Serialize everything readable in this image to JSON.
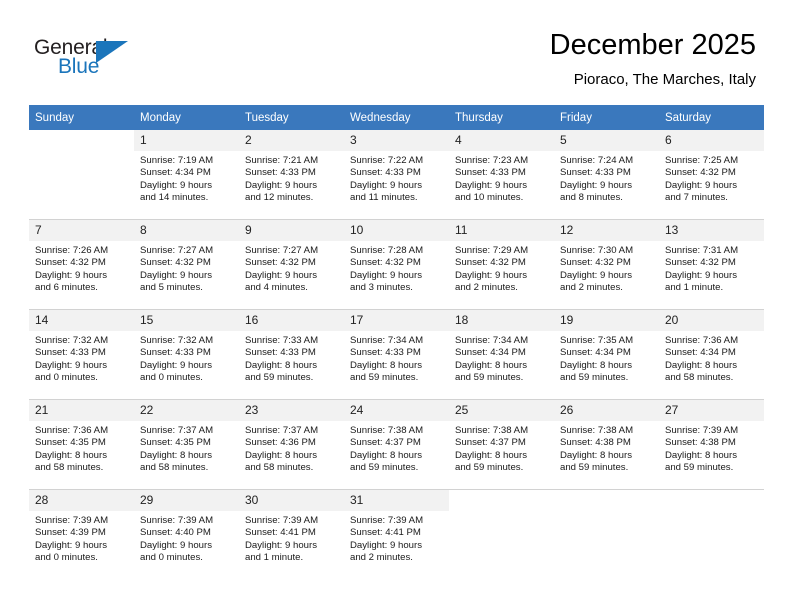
{
  "brand": {
    "name_part1": "General",
    "name_part2": "Blue",
    "triangle_color": "#1b75bb"
  },
  "header": {
    "title": "December 2025",
    "subtitle": "Pioraco, The Marches, Italy",
    "header_bg": "#3a78bd"
  },
  "weekdays": [
    "Sunday",
    "Monday",
    "Tuesday",
    "Wednesday",
    "Thursday",
    "Friday",
    "Saturday"
  ],
  "labels": {
    "sunrise": "Sunrise:",
    "sunset": "Sunset:",
    "daylight": "Daylight:"
  },
  "weeks": [
    [
      {
        "day": "",
        "sunrise": "",
        "sunset": "",
        "daylight1": "",
        "daylight2": ""
      },
      {
        "day": "1",
        "sunrise": "Sunrise: 7:19 AM",
        "sunset": "Sunset: 4:34 PM",
        "daylight1": "Daylight: 9 hours",
        "daylight2": "and 14 minutes."
      },
      {
        "day": "2",
        "sunrise": "Sunrise: 7:21 AM",
        "sunset": "Sunset: 4:33 PM",
        "daylight1": "Daylight: 9 hours",
        "daylight2": "and 12 minutes."
      },
      {
        "day": "3",
        "sunrise": "Sunrise: 7:22 AM",
        "sunset": "Sunset: 4:33 PM",
        "daylight1": "Daylight: 9 hours",
        "daylight2": "and 11 minutes."
      },
      {
        "day": "4",
        "sunrise": "Sunrise: 7:23 AM",
        "sunset": "Sunset: 4:33 PM",
        "daylight1": "Daylight: 9 hours",
        "daylight2": "and 10 minutes."
      },
      {
        "day": "5",
        "sunrise": "Sunrise: 7:24 AM",
        "sunset": "Sunset: 4:33 PM",
        "daylight1": "Daylight: 9 hours",
        "daylight2": "and 8 minutes."
      },
      {
        "day": "6",
        "sunrise": "Sunrise: 7:25 AM",
        "sunset": "Sunset: 4:32 PM",
        "daylight1": "Daylight: 9 hours",
        "daylight2": "and 7 minutes."
      }
    ],
    [
      {
        "day": "7",
        "sunrise": "Sunrise: 7:26 AM",
        "sunset": "Sunset: 4:32 PM",
        "daylight1": "Daylight: 9 hours",
        "daylight2": "and 6 minutes."
      },
      {
        "day": "8",
        "sunrise": "Sunrise: 7:27 AM",
        "sunset": "Sunset: 4:32 PM",
        "daylight1": "Daylight: 9 hours",
        "daylight2": "and 5 minutes."
      },
      {
        "day": "9",
        "sunrise": "Sunrise: 7:27 AM",
        "sunset": "Sunset: 4:32 PM",
        "daylight1": "Daylight: 9 hours",
        "daylight2": "and 4 minutes."
      },
      {
        "day": "10",
        "sunrise": "Sunrise: 7:28 AM",
        "sunset": "Sunset: 4:32 PM",
        "daylight1": "Daylight: 9 hours",
        "daylight2": "and 3 minutes."
      },
      {
        "day": "11",
        "sunrise": "Sunrise: 7:29 AM",
        "sunset": "Sunset: 4:32 PM",
        "daylight1": "Daylight: 9 hours",
        "daylight2": "and 2 minutes."
      },
      {
        "day": "12",
        "sunrise": "Sunrise: 7:30 AM",
        "sunset": "Sunset: 4:32 PM",
        "daylight1": "Daylight: 9 hours",
        "daylight2": "and 2 minutes."
      },
      {
        "day": "13",
        "sunrise": "Sunrise: 7:31 AM",
        "sunset": "Sunset: 4:32 PM",
        "daylight1": "Daylight: 9 hours",
        "daylight2": "and 1 minute."
      }
    ],
    [
      {
        "day": "14",
        "sunrise": "Sunrise: 7:32 AM",
        "sunset": "Sunset: 4:33 PM",
        "daylight1": "Daylight: 9 hours",
        "daylight2": "and 0 minutes."
      },
      {
        "day": "15",
        "sunrise": "Sunrise: 7:32 AM",
        "sunset": "Sunset: 4:33 PM",
        "daylight1": "Daylight: 9 hours",
        "daylight2": "and 0 minutes."
      },
      {
        "day": "16",
        "sunrise": "Sunrise: 7:33 AM",
        "sunset": "Sunset: 4:33 PM",
        "daylight1": "Daylight: 8 hours",
        "daylight2": "and 59 minutes."
      },
      {
        "day": "17",
        "sunrise": "Sunrise: 7:34 AM",
        "sunset": "Sunset: 4:33 PM",
        "daylight1": "Daylight: 8 hours",
        "daylight2": "and 59 minutes."
      },
      {
        "day": "18",
        "sunrise": "Sunrise: 7:34 AM",
        "sunset": "Sunset: 4:34 PM",
        "daylight1": "Daylight: 8 hours",
        "daylight2": "and 59 minutes."
      },
      {
        "day": "19",
        "sunrise": "Sunrise: 7:35 AM",
        "sunset": "Sunset: 4:34 PM",
        "daylight1": "Daylight: 8 hours",
        "daylight2": "and 59 minutes."
      },
      {
        "day": "20",
        "sunrise": "Sunrise: 7:36 AM",
        "sunset": "Sunset: 4:34 PM",
        "daylight1": "Daylight: 8 hours",
        "daylight2": "and 58 minutes."
      }
    ],
    [
      {
        "day": "21",
        "sunrise": "Sunrise: 7:36 AM",
        "sunset": "Sunset: 4:35 PM",
        "daylight1": "Daylight: 8 hours",
        "daylight2": "and 58 minutes."
      },
      {
        "day": "22",
        "sunrise": "Sunrise: 7:37 AM",
        "sunset": "Sunset: 4:35 PM",
        "daylight1": "Daylight: 8 hours",
        "daylight2": "and 58 minutes."
      },
      {
        "day": "23",
        "sunrise": "Sunrise: 7:37 AM",
        "sunset": "Sunset: 4:36 PM",
        "daylight1": "Daylight: 8 hours",
        "daylight2": "and 58 minutes."
      },
      {
        "day": "24",
        "sunrise": "Sunrise: 7:38 AM",
        "sunset": "Sunset: 4:37 PM",
        "daylight1": "Daylight: 8 hours",
        "daylight2": "and 59 minutes."
      },
      {
        "day": "25",
        "sunrise": "Sunrise: 7:38 AM",
        "sunset": "Sunset: 4:37 PM",
        "daylight1": "Daylight: 8 hours",
        "daylight2": "and 59 minutes."
      },
      {
        "day": "26",
        "sunrise": "Sunrise: 7:38 AM",
        "sunset": "Sunset: 4:38 PM",
        "daylight1": "Daylight: 8 hours",
        "daylight2": "and 59 minutes."
      },
      {
        "day": "27",
        "sunrise": "Sunrise: 7:39 AM",
        "sunset": "Sunset: 4:38 PM",
        "daylight1": "Daylight: 8 hours",
        "daylight2": "and 59 minutes."
      }
    ],
    [
      {
        "day": "28",
        "sunrise": "Sunrise: 7:39 AM",
        "sunset": "Sunset: 4:39 PM",
        "daylight1": "Daylight: 9 hours",
        "daylight2": "and 0 minutes."
      },
      {
        "day": "29",
        "sunrise": "Sunrise: 7:39 AM",
        "sunset": "Sunset: 4:40 PM",
        "daylight1": "Daylight: 9 hours",
        "daylight2": "and 0 minutes."
      },
      {
        "day": "30",
        "sunrise": "Sunrise: 7:39 AM",
        "sunset": "Sunset: 4:41 PM",
        "daylight1": "Daylight: 9 hours",
        "daylight2": "and 1 minute."
      },
      {
        "day": "31",
        "sunrise": "Sunrise: 7:39 AM",
        "sunset": "Sunset: 4:41 PM",
        "daylight1": "Daylight: 9 hours",
        "daylight2": "and 2 minutes."
      },
      {
        "day": "",
        "sunrise": "",
        "sunset": "",
        "daylight1": "",
        "daylight2": ""
      },
      {
        "day": "",
        "sunrise": "",
        "sunset": "",
        "daylight1": "",
        "daylight2": ""
      },
      {
        "day": "",
        "sunrise": "",
        "sunset": "",
        "daylight1": "",
        "daylight2": ""
      }
    ]
  ]
}
